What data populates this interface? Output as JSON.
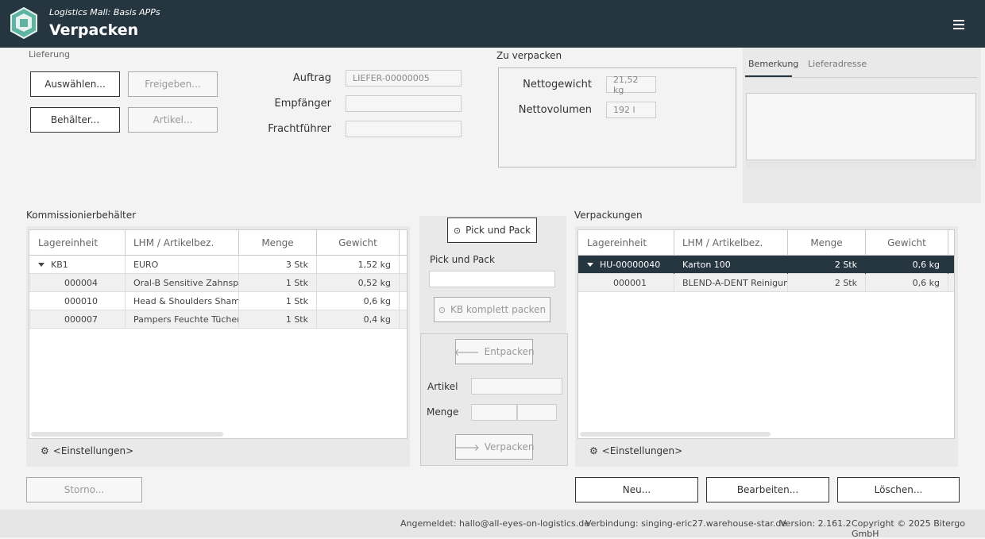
{
  "header": {
    "subtitle": "Logistics Mall: Basis APPs",
    "title": "Verpacken",
    "menu_icon": "hamburger-menu-icon"
  },
  "lieferung": {
    "section_label": "Lieferung",
    "btn_auswaehlen": "Auswählen...",
    "btn_freigeben": "Freigeben...",
    "btn_behaelter": "Behälter...",
    "btn_artikel": "Artikel..."
  },
  "auftrag": {
    "auftrag_label": "Auftrag",
    "auftrag_value": "LIEFER-00000005",
    "empfaenger_label": "Empfänger",
    "empfaenger_value": "",
    "frachtfuehrer_label": "Frachtführer",
    "frachtfuehrer_value": ""
  },
  "zu_verpacken": {
    "title": "Zu verpacken",
    "nettogewicht_label": "Nettogewicht",
    "nettogewicht_value": "21,52 kg",
    "nettovolumen_label": "Nettovolumen",
    "nettovolumen_value": "192 l"
  },
  "tabs": {
    "bemerkung": "Bemerkung",
    "lieferadresse": "Lieferadresse",
    "bemerkung_text": ""
  },
  "kommissionier": {
    "title": "Kommissionierbehälter",
    "columns": [
      "Lagereinheit",
      "LHM / Artikelbez.",
      "Menge",
      "Gewicht"
    ],
    "rows": [
      {
        "lagereinheit": "KB1",
        "lhm": "EURO",
        "menge": "3 Stk",
        "gewicht": "1,52 kg"
      },
      {
        "lagereinheit": "000004",
        "lhm": "Oral-B Sensitive Zahnspülung",
        "menge": "1 Stk",
        "gewicht": "0,52 kg"
      },
      {
        "lagereinheit": "000010",
        "lhm": "Head & Shoulders Shampoo",
        "menge": "1 Stk",
        "gewicht": "0,6 kg"
      },
      {
        "lagereinheit": "000007",
        "lhm": "Pampers Feuchte Tücher Baby",
        "menge": "1 Stk",
        "gewicht": "0,4 kg"
      }
    ],
    "settings_label": "<Einstellungen>"
  },
  "middle": {
    "btn_pick_und_pack": "Pick und Pack",
    "pick_und_pack_label": "Pick und Pack",
    "pick_input": "",
    "btn_kb_komplett": "KB komplett packen",
    "btn_entpacken": "Entpacken",
    "artikel_label": "Artikel",
    "menge_label": "Menge",
    "btn_verpacken": "Verpacken"
  },
  "verpackungen": {
    "title": "Verpackungen",
    "columns": [
      "Lagereinheit",
      "LHM / Artikelbez.",
      "Menge",
      "Gewicht"
    ],
    "rows": [
      {
        "lagereinheit": "HU-00000040",
        "lhm": "Karton 100",
        "menge": "2 Stk",
        "gewicht": "0,6 kg"
      },
      {
        "lagereinheit": "000001",
        "lhm": "BLEND-A-DENT Reinigungstabs",
        "menge": "2 Stk",
        "gewicht": "0,6 kg"
      }
    ],
    "settings_label": "<Einstellungen>"
  },
  "bottom": {
    "btn_storno": "Storno...",
    "btn_neu": "Neu...",
    "btn_bearbeiten": "Bearbeiten...",
    "btn_loeschen": "Löschen..."
  },
  "footer": {
    "angemeldet": "Angemeldet: hallo@all-eyes-on-logistics.de",
    "verbindung": "Verbindung: singing-eric27.warehouse-star.de",
    "version": "Version: 2.161.2",
    "copyright": "Copyright © 2025 Bitergo GmbH"
  },
  "colors": {
    "header_bg": "#253641",
    "selected_row_bg": "#253641"
  }
}
